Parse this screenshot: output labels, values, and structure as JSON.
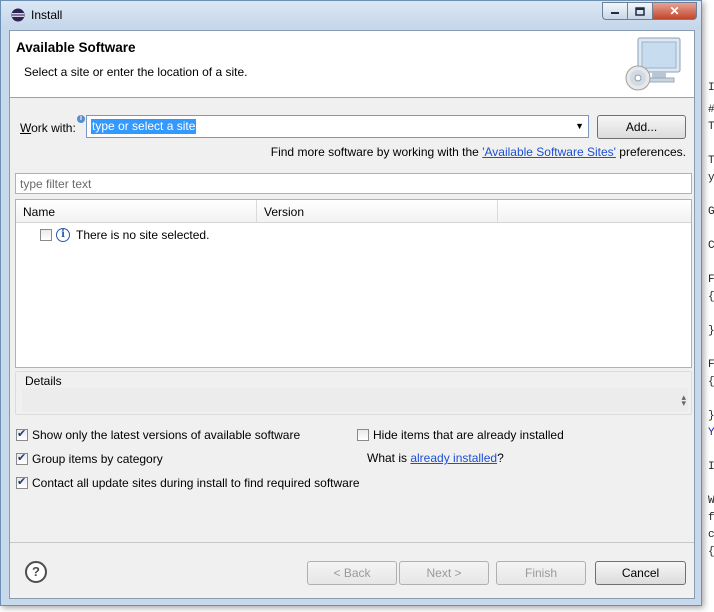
{
  "window": {
    "title": "Install",
    "controls": {
      "close_symbol": "✕"
    }
  },
  "banner": {
    "title": "Available Software",
    "description": "Select a site or enter the location of a site.",
    "image_icon": "monitor-cd-icon"
  },
  "work_with": {
    "label_prefix": "",
    "label_mnemonic": "W",
    "label_rest": "ork with:",
    "value": "type or select a site",
    "add_button": "Add...",
    "find_more_prefix": "Find more software by working with the ",
    "find_more_link": "'Available Software Sites'",
    "find_more_suffix": " preferences."
  },
  "filter": {
    "placeholder": "type filter text"
  },
  "tree": {
    "columns": [
      "Name",
      "Version"
    ],
    "message": "There is no site selected."
  },
  "details": {
    "label": "Details"
  },
  "options": {
    "show_latest": {
      "label": "Show only the latest versions of available software",
      "checked": true
    },
    "group_by_category": {
      "label": "Group items by category",
      "checked": true
    },
    "contact_all": {
      "label": "Contact all update sites during install to find required software",
      "checked": true
    },
    "hide_installed": {
      "label": "Hide items that are already installed",
      "checked": false
    },
    "what_is_prefix": "What is ",
    "what_is_link": "already installed",
    "what_is_suffix": "?"
  },
  "buttons": {
    "back": "< Back",
    "next": "Next >",
    "finish": "Finish",
    "cancel": "Cancel",
    "help": "?"
  },
  "background_editor": {
    "lines": [
      "I",
      "#",
      "T",
      "T",
      "y",
      "G",
      "C",
      "F",
      "{",
      "}",
      "F",
      "{",
      "}",
      "Y",
      "I",
      "W",
      "f",
      "c",
      "{"
    ]
  }
}
